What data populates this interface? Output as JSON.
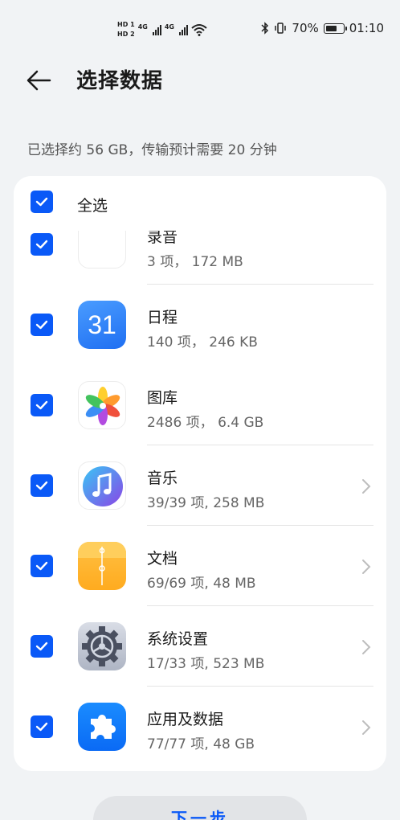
{
  "status_bar": {
    "sim1": "HD 1",
    "sim2": "HD 2",
    "net1": "4G",
    "net2": "4G",
    "battery_text": "70%",
    "battery_level": 0.7,
    "time": "01:10"
  },
  "header": {
    "title": "选择数据"
  },
  "summary": "已选择约 56 GB，传输预计需要 20 分钟",
  "select_all": {
    "label": "全选",
    "checked": true
  },
  "items": [
    {
      "name": "录音",
      "meta": "3 项， 172 MB",
      "icon": "voice-recorder-icon",
      "checked": true,
      "has_chevron": false
    },
    {
      "name": "日程",
      "meta": "140 项， 246 KB",
      "icon": "calendar-icon",
      "icon_text": "31",
      "checked": true,
      "has_chevron": false
    },
    {
      "name": "图库",
      "meta": "2486 项， 6.4 GB",
      "icon": "gallery-icon",
      "checked": true,
      "has_chevron": false
    },
    {
      "name": "音乐",
      "meta": "39/39 项, 258 MB",
      "icon": "music-icon",
      "checked": true,
      "has_chevron": true
    },
    {
      "name": "文档",
      "meta": "69/69 项, 48 MB",
      "icon": "files-icon",
      "checked": true,
      "has_chevron": true
    },
    {
      "name": "系统设置",
      "meta": "17/33 项, 523 MB",
      "icon": "settings-icon",
      "checked": true,
      "has_chevron": true
    },
    {
      "name": "应用及数据",
      "meta": "77/77 项, 48 GB",
      "icon": "apps-icon",
      "checked": true,
      "has_chevron": true
    }
  ],
  "next_button": "下一步",
  "colors": {
    "accent": "#0a59f7",
    "background": "#f1f3f5"
  }
}
